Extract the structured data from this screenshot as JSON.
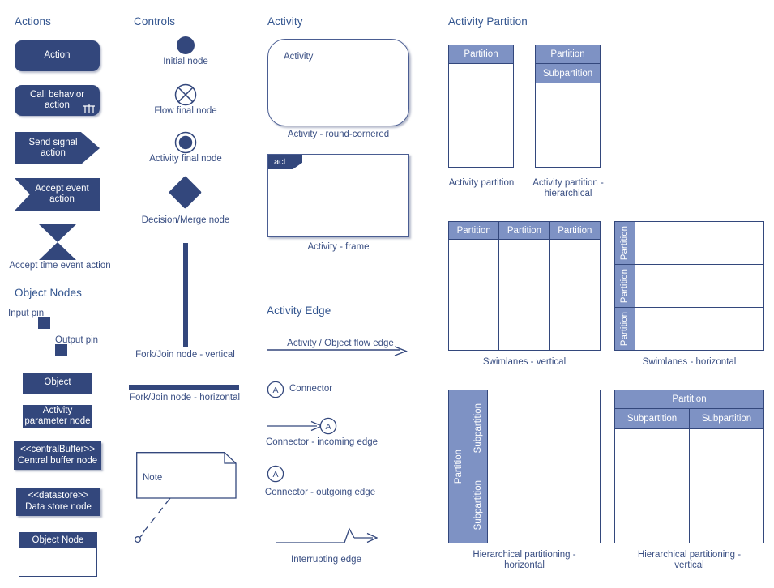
{
  "sections": {
    "actions": "Actions",
    "object_nodes": "Object Nodes",
    "controls": "Controls",
    "activity": "Activity",
    "activity_edge": "Activity Edge",
    "activity_partition": "Activity Partition"
  },
  "colors": {
    "navy": "#33477c",
    "light_blue": "#7e92c4",
    "text_blue": "#3a4f83",
    "title_blue": "#33558f",
    "white": "#ffffff"
  },
  "actions": {
    "action": {
      "label": "Action"
    },
    "call_behavior": {
      "label": "Call behavior\naction",
      "line1": "Call behavior",
      "line2": "action",
      "icon": "rake-icon"
    },
    "send_signal": {
      "line1": "Send signal",
      "line2": "action"
    },
    "accept_event": {
      "line1": "Accept event",
      "line2": "action"
    },
    "accept_time_event": {
      "caption": "Accept time event action"
    }
  },
  "object_nodes": {
    "input_pin": {
      "caption": "Input pin"
    },
    "output_pin": {
      "caption": "Output pin"
    },
    "object": {
      "label": "Object"
    },
    "activity_parameter": {
      "line1": "Activity",
      "line2": "parameter node"
    },
    "central_buffer": {
      "stereotype": "<<centralBuffer>>",
      "label": "Central buffer node"
    },
    "data_store": {
      "stereotype": "<<datastore>>",
      "label": "Data store node"
    },
    "object_node": {
      "label": "Object Node"
    }
  },
  "controls": {
    "initial_node": {
      "caption": "Initial node"
    },
    "flow_final_node": {
      "caption": "Flow final node"
    },
    "activity_final_node": {
      "caption": "Activity final node"
    },
    "decision_merge_node": {
      "caption": "Decision/Merge node"
    },
    "fork_join_vertical": {
      "caption": "Fork/Join node - vertical"
    },
    "fork_join_horizontal": {
      "caption": "Fork/Join node - horizontal"
    },
    "note": {
      "label": "Note"
    }
  },
  "activity": {
    "round_cornered": {
      "label": "Activity",
      "caption": "Activity - round-cornered"
    },
    "frame": {
      "tab": "act",
      "caption": "Activity - frame"
    }
  },
  "activity_edge": {
    "flow_edge": {
      "label": "Activity / Object flow edge"
    },
    "connector": {
      "letter": "A",
      "label": "Connector"
    },
    "connector_incoming": {
      "letter": "A",
      "caption": "Connector - incoming edge"
    },
    "connector_outgoing": {
      "letter": "A",
      "caption": "Connector - outgoing edge"
    },
    "interrupting_edge": {
      "caption": "Interrupting edge"
    }
  },
  "activity_partition": {
    "simple": {
      "header": "Partition",
      "caption": "Activity partition"
    },
    "hierarchical": {
      "header": "Partition",
      "subheader": "Subpartition",
      "caption_line1": "Activity partition -",
      "caption_line2": "hierarchical"
    },
    "swimlanes_vertical": {
      "headers": [
        "Partition",
        "Partition",
        "Partition"
      ],
      "caption": "Swimlanes - vertical"
    },
    "swimlanes_horizontal": {
      "headers": [
        "Partition",
        "Partition",
        "Partition"
      ],
      "caption": "Swimlanes - horizontal"
    },
    "hier_horizontal": {
      "partition": "Partition",
      "subpartitions": [
        "Subpartition",
        "Subpartition"
      ],
      "caption_line1": "Hierarchical partitioning -",
      "caption_line2": "horizontal"
    },
    "hier_vertical": {
      "partition": "Partition",
      "subpartitions": [
        "Subpartition",
        "Subpartition"
      ],
      "caption_line1": "Hierarchical partitioning -",
      "caption_line2": "vertical"
    }
  }
}
